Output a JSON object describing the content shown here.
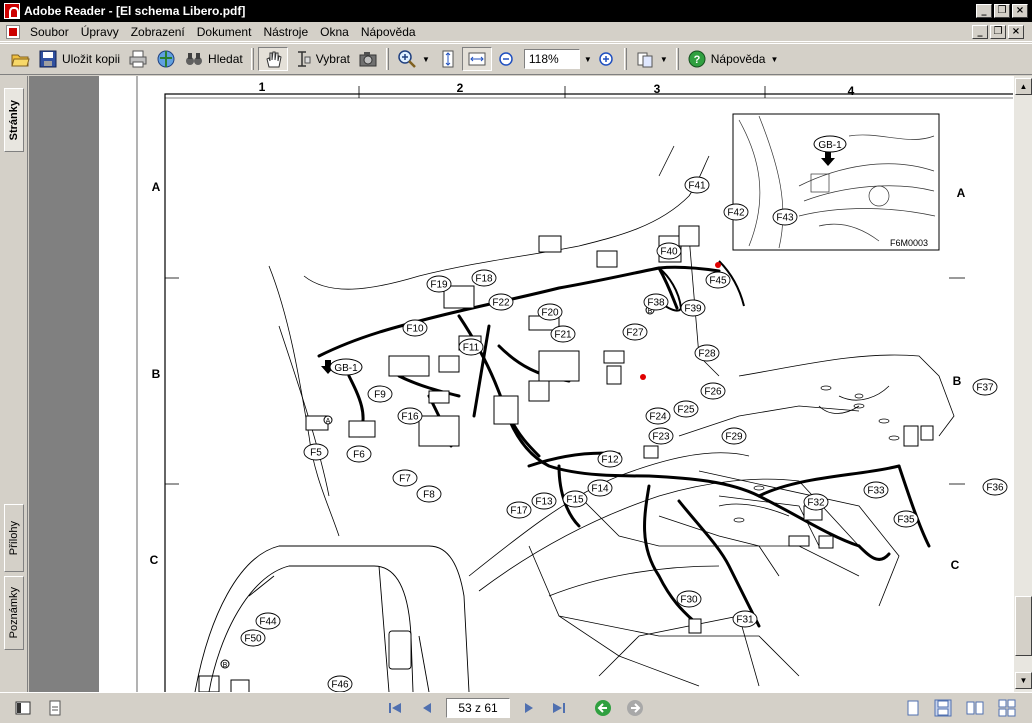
{
  "window": {
    "title": "Adobe Reader - [El schema Libero.pdf]"
  },
  "menu": {
    "items": [
      "Soubor",
      "Úpravy",
      "Zobrazení",
      "Dokument",
      "Nástroje",
      "Okna",
      "Nápověda"
    ]
  },
  "toolbar": {
    "save_copy_label": "Uložit kopii",
    "search_label": "Hledat",
    "select_label": "Vybrat",
    "zoom_value": "118%",
    "help_label": "Nápověda"
  },
  "side_tabs": {
    "pages": "Stránky",
    "attachments": "Přílohy",
    "comments": "Poznámky"
  },
  "status": {
    "page_indicator": "53 z 61"
  },
  "drawing": {
    "columns": [
      "1",
      "2",
      "3",
      "4"
    ],
    "rows": [
      "A",
      "B",
      "C"
    ],
    "inset_code": "F6M0003",
    "ground_label": "GB-1",
    "connectors": [
      "F5",
      "F6",
      "F7",
      "F8",
      "F9",
      "F10",
      "F11",
      "F12",
      "F13",
      "F14",
      "F15",
      "F16",
      "F17",
      "F18",
      "F19",
      "F20",
      "F21",
      "F22",
      "F23",
      "F24",
      "F25",
      "F26",
      "F27",
      "F28",
      "F29",
      "F30",
      "F31",
      "F32",
      "F33",
      "F35",
      "F36",
      "F37",
      "F38",
      "F39",
      "F40",
      "F41",
      "F42",
      "F43",
      "F44",
      "F45",
      "F46",
      "F50"
    ],
    "point_labels": [
      "A",
      "B"
    ]
  }
}
